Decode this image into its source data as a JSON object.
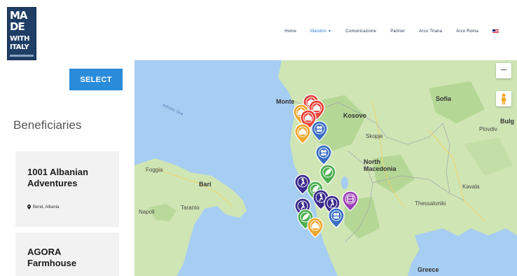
{
  "logo": {
    "line1": "MA",
    "line2": "DE",
    "line3": "WITH",
    "line4": "ITALY"
  },
  "nav": {
    "items": [
      "Home",
      "Mandrio",
      "Comunicazione",
      "Partner",
      "Arco Tirana",
      "Arco Roma"
    ],
    "active_index": 1
  },
  "sidebar": {
    "select_label": "SELECT",
    "title": "Beneficiaries",
    "cards": [
      {
        "name": "1001 Albanian Adventures",
        "location": "Berat, Albania"
      },
      {
        "name": "AGORA Farmhouse",
        "location": ""
      }
    ]
  },
  "map": {
    "zoom_out_label": "−",
    "labels": {
      "montenegro": "Monte",
      "kosovo": "Kosovo",
      "skopje": "Skopje",
      "north_macedonia": "North Macedonia",
      "sofia": "Sofia",
      "bulgaria": "Bulg",
      "plovdiv": "Plovdiv",
      "thessaloniki": "Thessaloniki",
      "greece": "Greece",
      "foggia": "Foggia",
      "bari": "Bari",
      "taranto": "Taranto",
      "naples": "Napoli",
      "kavala": "Kavala",
      "adriatic_sea": "Adriatic Sea"
    },
    "markers": [
      {
        "color": "#e8443a",
        "icon": "home-icon"
      },
      {
        "color": "#e8443a",
        "icon": "home-icon"
      },
      {
        "color": "#f0a830",
        "icon": "home-icon"
      },
      {
        "color": "#e8443a",
        "icon": "home-icon"
      },
      {
        "color": "#3a6fc4",
        "icon": "people-icon"
      },
      {
        "color": "#f0a830",
        "icon": "home-icon"
      },
      {
        "color": "#3a6fc4",
        "icon": "people-icon"
      },
      {
        "color": "#4caf50",
        "icon": "leaf-icon"
      },
      {
        "color": "#3b2a8c",
        "icon": "hiking-icon"
      },
      {
        "color": "#4caf50",
        "icon": "leaf-icon"
      },
      {
        "color": "#3b2a8c",
        "icon": "hiking-icon"
      },
      {
        "color": "#3b2a8c",
        "icon": "hiking-icon"
      },
      {
        "color": "#9c3fb5",
        "icon": "crafts-icon"
      },
      {
        "color": "#3b2a8c",
        "icon": "hiking-icon"
      },
      {
        "color": "#4caf50",
        "icon": "leaf-icon"
      },
      {
        "color": "#3a6fc4",
        "icon": "people-icon"
      },
      {
        "color": "#f0a830",
        "icon": "home-icon"
      }
    ]
  },
  "colors": {
    "accent": "#2a8bdb",
    "sea": "#a6cdf2",
    "land": "#cfe5b4"
  }
}
